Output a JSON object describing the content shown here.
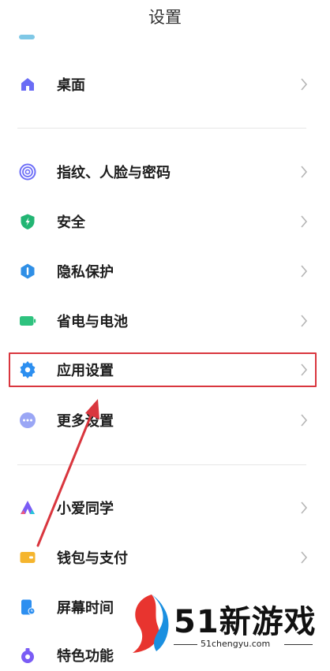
{
  "header": {
    "title": "设置"
  },
  "groups": [
    {
      "items": [
        {
          "label": "桌面",
          "icon": "home-icon",
          "color": "#6a6cf5"
        }
      ]
    },
    {
      "items": [
        {
          "label": "指纹、人脸与密码",
          "icon": "fingerprint-icon",
          "color": "#6d6ef7"
        },
        {
          "label": "安全",
          "icon": "shield-icon",
          "color": "#22b573"
        },
        {
          "label": "隐私保护",
          "icon": "privacy-icon",
          "color": "#2f8fe6"
        },
        {
          "label": "省电与电池",
          "icon": "battery-icon",
          "color": "#2ec27e"
        },
        {
          "label": "应用设置",
          "icon": "gear-icon",
          "color": "#2d8ff0"
        },
        {
          "label": "更多设置",
          "icon": "more-icon",
          "color": "#9aa6f5"
        }
      ]
    },
    {
      "items": [
        {
          "label": "小爱同学",
          "icon": "xiaoai-icon",
          "color": "#7a5cf5"
        },
        {
          "label": "钱包与支付",
          "icon": "wallet-icon",
          "color": "#f5b52e"
        },
        {
          "label": "屏幕时间",
          "icon": "screen-time-icon",
          "color": "#2d8ff0"
        },
        {
          "label": "特色功能",
          "icon": "feature-icon",
          "color": "#7a5cf5"
        }
      ]
    }
  ],
  "annotation": {
    "highlighted_item": "应用设置",
    "highlight_color": "#d9363e"
  },
  "watermark": {
    "brand": "51新游戏",
    "site": "51chengyu.com"
  }
}
